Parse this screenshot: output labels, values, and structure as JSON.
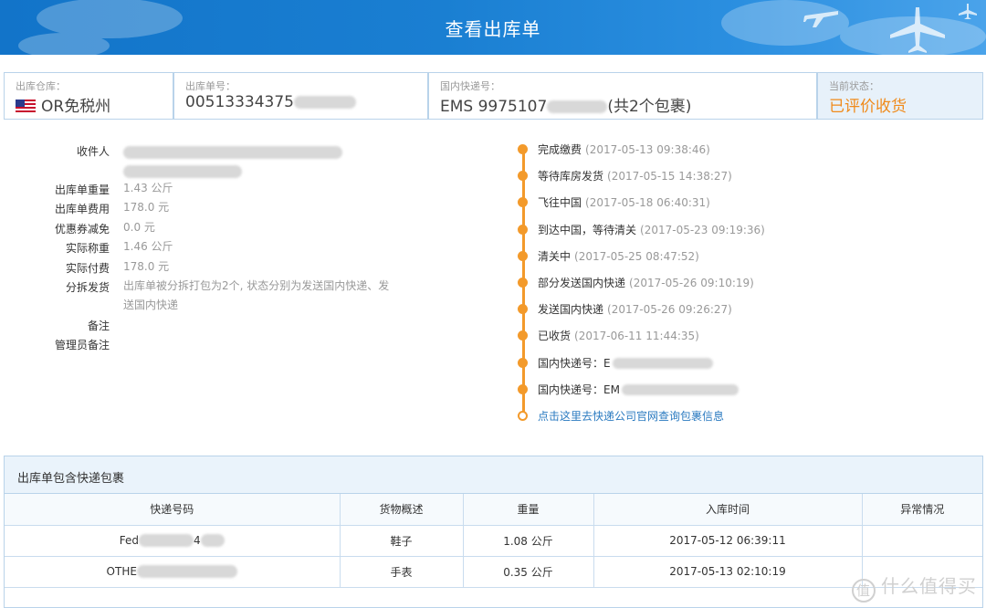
{
  "header": {
    "title": "查看出库单"
  },
  "summary": {
    "warehouse": {
      "label": "出库仓库：",
      "value": "OR免税州"
    },
    "order_no": {
      "label": "出库单号：",
      "value": "00513334375"
    },
    "express_no": {
      "label": "国内快递号：",
      "prefix": "EMS 9975107",
      "suffix": "(共2个包裹)"
    },
    "status": {
      "label": "当前状态：",
      "value": "已评价收货",
      "color": "#f08a1a"
    }
  },
  "details": {
    "recipient_label": "收件人",
    "weight_label": "出库单重量",
    "weight": "1.43 公斤",
    "fee_label": "出库单费用",
    "fee": "178.0 元",
    "coupon_label": "优惠券减免",
    "coupon": "0.0 元",
    "actual_weight_label": "实际称重",
    "actual_weight": "1.46 公斤",
    "actual_pay_label": "实际付费",
    "actual_pay": "178.0 元",
    "split_label": "分拆发货",
    "split": "出库单被分拆打包为2个, 状态分别为发送国内快递、发送国内快递",
    "remark_label": "备注",
    "admin_remark_label": "管理员备注"
  },
  "timeline": [
    {
      "text": "完成缴费",
      "time": "(2017-05-13 09:38:46)"
    },
    {
      "text": "等待库房发货",
      "time": "(2017-05-15 14:38:27)"
    },
    {
      "text": "飞往中国",
      "time": "(2017-05-18 06:40:31)"
    },
    {
      "text": "到达中国，等待清关",
      "time": "(2017-05-23 09:19:36)"
    },
    {
      "text": "清关中",
      "time": "(2017-05-25 08:47:52)"
    },
    {
      "text": "部分发送国内快递",
      "time": "(2017-05-26 09:10:19)"
    },
    {
      "text": "发送国内快递",
      "time": "(2017-05-26 09:26:27)"
    },
    {
      "text": "已收货",
      "time": "(2017-06-11 11:44:35)"
    },
    {
      "text": "国内快递号：E",
      "time": ""
    },
    {
      "text": "国内快递号：EM",
      "time": ""
    }
  ],
  "timeline_link": "点击这里去快递公司官网查询包裹信息",
  "packages": {
    "title": "出库单包含快递包裹",
    "columns": [
      "快递号码",
      "货物概述",
      "重量",
      "入库时间",
      "异常情况"
    ],
    "rows": [
      {
        "tracking": "Fed",
        "tracking_tail": "4",
        "goods": "鞋子",
        "weight": "1.08 公斤",
        "time": "2017-05-12 06:39:11",
        "exception": ""
      },
      {
        "tracking": "OTHE",
        "tracking_tail": "",
        "goods": "手表",
        "weight": "0.35 公斤",
        "time": "2017-05-13 02:10:19",
        "exception": ""
      }
    ]
  },
  "watermark": {
    "logo": "值",
    "text": "什么值得买"
  }
}
